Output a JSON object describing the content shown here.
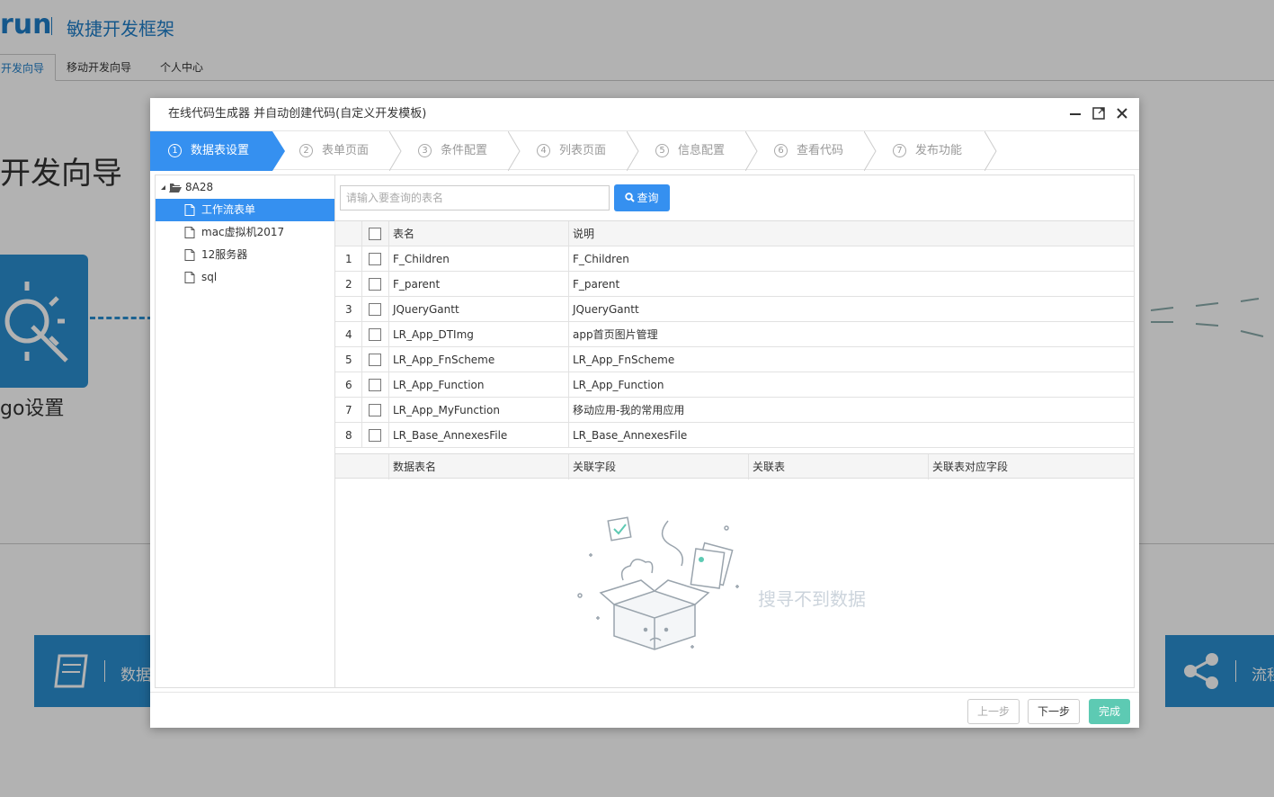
{
  "background": {
    "logo": "run",
    "subtitle": "敏捷开发框架",
    "tabs": [
      "开发向导",
      "移动开发向导",
      "个人中心"
    ],
    "page_title": "开发向导",
    "gear_label": "go设置",
    "card_left_label": "数据",
    "card_right_label": "流程"
  },
  "dialog": {
    "title": "在线代码生成器 并自动创建代码(自定义开发模板)",
    "steps": [
      {
        "num": "1",
        "label": "数据表设置"
      },
      {
        "num": "2",
        "label": "表单页面"
      },
      {
        "num": "3",
        "label": "条件配置"
      },
      {
        "num": "4",
        "label": "列表页面"
      },
      {
        "num": "5",
        "label": "信息配置"
      },
      {
        "num": "6",
        "label": "查看代码"
      },
      {
        "num": "7",
        "label": "发布功能"
      }
    ],
    "tree": {
      "root": "8A28",
      "items": [
        "工作流表单",
        "mac虚拟机2017",
        "12服务器",
        "sql"
      ]
    },
    "search": {
      "placeholder": "请输入要查询的表名",
      "button": "查询"
    },
    "table": {
      "headers": [
        "表名",
        "说明"
      ],
      "rows": [
        {
          "no": "1",
          "name": "F_Children",
          "desc": "F_Children"
        },
        {
          "no": "2",
          "name": "F_parent",
          "desc": "F_parent"
        },
        {
          "no": "3",
          "name": "JQueryGantt",
          "desc": "JQueryGantt"
        },
        {
          "no": "4",
          "name": "LR_App_DTImg",
          "desc": "app首页图片管理"
        },
        {
          "no": "5",
          "name": "LR_App_FnScheme",
          "desc": "LR_App_FnScheme"
        },
        {
          "no": "6",
          "name": "LR_App_Function",
          "desc": "LR_App_Function"
        },
        {
          "no": "7",
          "name": "LR_App_MyFunction",
          "desc": "移动应用-我的常用应用"
        },
        {
          "no": "8",
          "name": "LR_Base_AnnexesFile",
          "desc": "LR_Base_AnnexesFile"
        }
      ]
    },
    "relation_table": {
      "headers": [
        "数据表名",
        "关联字段",
        "关联表",
        "关联表对应字段"
      ],
      "empty_text": "搜寻不到数据"
    },
    "footer": {
      "prev": "上一步",
      "next": "下一步",
      "finish": "完成"
    }
  },
  "colors": {
    "accent": "#3590f0",
    "brand": "#1e7dc8",
    "finish": "#5dcab3"
  }
}
